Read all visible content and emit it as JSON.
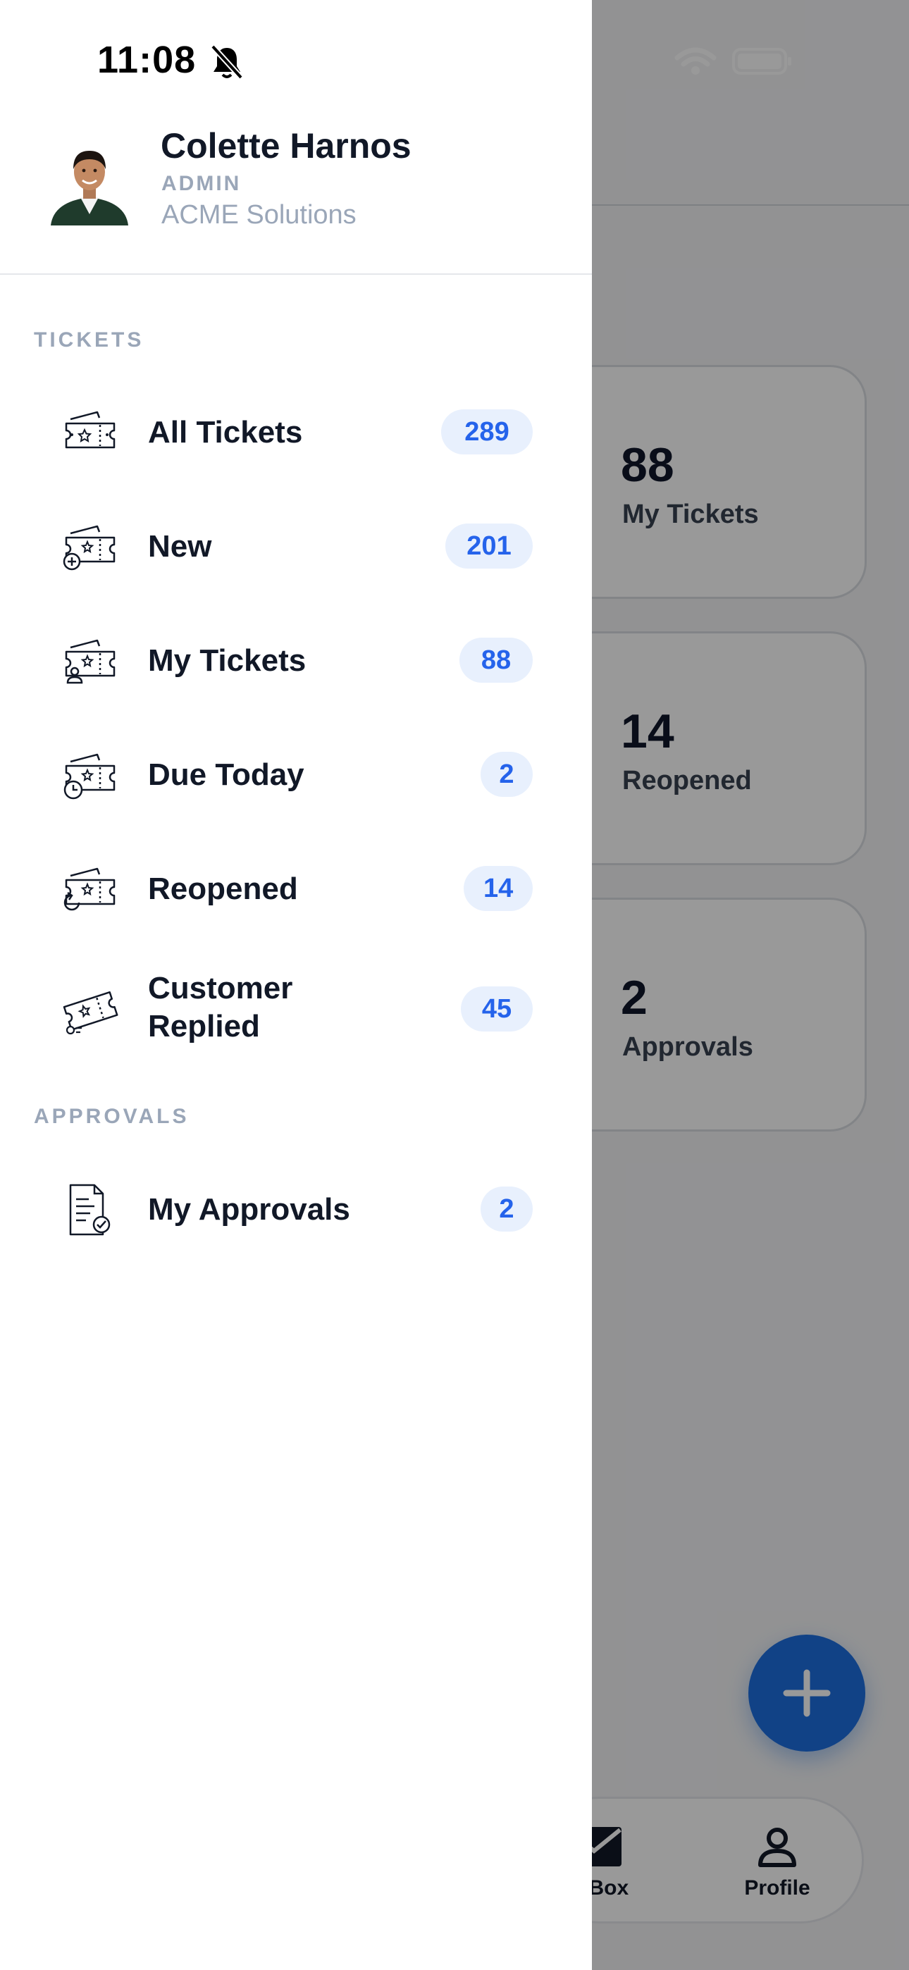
{
  "status_bar": {
    "time": "11:08"
  },
  "background": {
    "stats": [
      {
        "value": "88",
        "label": "My Tickets"
      },
      {
        "value": "14",
        "label": "Reopened"
      },
      {
        "value": "2",
        "label": "Approvals"
      }
    ],
    "tabs": [
      {
        "label": "ail Box",
        "icon": "mail-icon"
      },
      {
        "label": "Profile",
        "icon": "person-icon"
      }
    ]
  },
  "profile": {
    "name": "Colette Harnos",
    "role": "ADMIN",
    "organization": "ACME Solutions"
  },
  "sections": {
    "tickets_title": "TICKETS",
    "approvals_title": "APPROVALS"
  },
  "ticket_items": [
    {
      "label": "All Tickets",
      "count": "289",
      "icon": "ticket-star-icon"
    },
    {
      "label": "New",
      "count": "201",
      "icon": "ticket-plus-icon"
    },
    {
      "label": "My Tickets",
      "count": "88",
      "icon": "ticket-user-icon"
    },
    {
      "label": "Due Today",
      "count": "2",
      "icon": "ticket-clock-icon"
    },
    {
      "label": "Reopened",
      "count": "14",
      "icon": "ticket-reopen-icon"
    },
    {
      "label_line1": "Customer",
      "label_line2": "Replied",
      "count": "45",
      "icon": "ticket-reply-icon"
    }
  ],
  "approval_items": [
    {
      "label": "My Approvals",
      "count": "2",
      "icon": "document-check-icon"
    }
  ],
  "colors": {
    "accent": "#1d6fe0",
    "badge_bg": "#e8f0fd",
    "badge_text": "#2563eb",
    "muted": "#9aa6b8"
  }
}
